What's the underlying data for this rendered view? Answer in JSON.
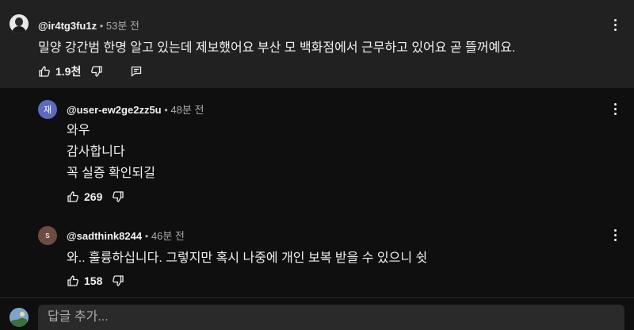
{
  "comments": [
    {
      "handle": "@ir4tg3fu1z",
      "time": "53분 전",
      "lines": [
        "밀양 강간범 한명 알고 있는데 제보했어요 부산 모 백화점에서 근무하고 있어요 곧 뜰꺼예요."
      ],
      "likes": "1.9천"
    },
    {
      "avatar_letter": "재",
      "avatar_color": "#5c6bc0",
      "handle": "@user-ew2ge2zz5u",
      "time": "48분 전",
      "lines": [
        "와우",
        "감사합니다",
        "꼭 실증 확인되길"
      ],
      "likes": "269"
    },
    {
      "avatar_letter": "s",
      "avatar_color": "#6d4c41",
      "handle": "@sadthink8244",
      "time": "46분 전",
      "lines": [
        "와.. 훌륭하십니다. 그렇지만 혹시 나중에 개인 보복 받을 수 있으니 쉿"
      ],
      "likes": "158"
    }
  ],
  "reply_placeholder": "답글 추가...",
  "colors": {
    "background": "#0f0f0f",
    "highlight": "#212121",
    "text": "#f1f1f1",
    "meta": "#aaaaaa"
  }
}
